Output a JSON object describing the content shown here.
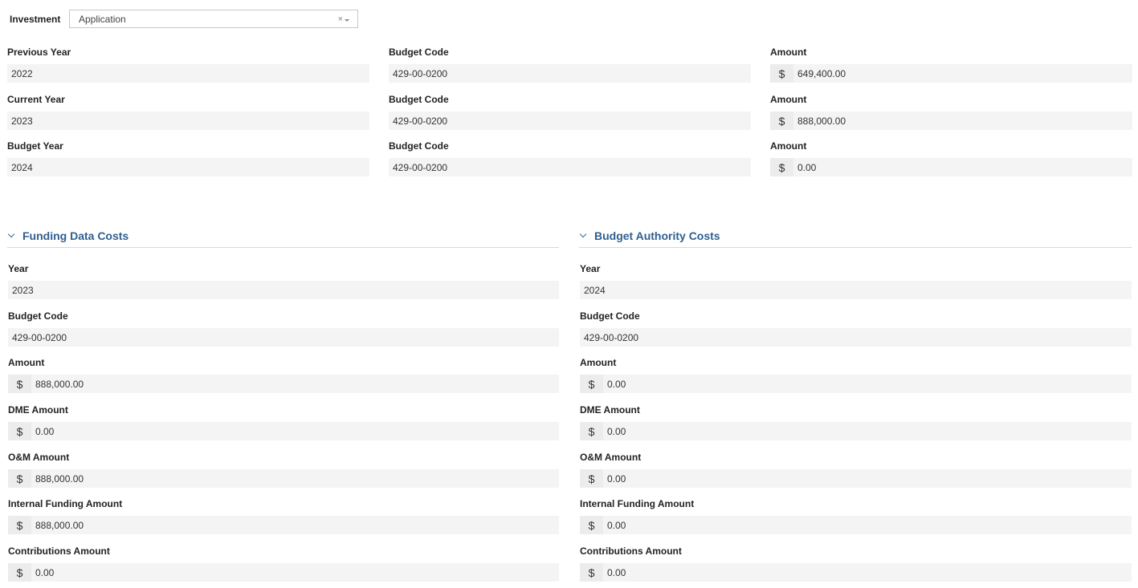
{
  "investment": {
    "label": "Investment",
    "value": "Application",
    "clear": "×"
  },
  "summary": [
    {
      "year_label": "Previous Year",
      "year": "2022",
      "code_label": "Budget Code",
      "code": "429-00-0200",
      "amount_label": "Amount",
      "amount": "649,400.00"
    },
    {
      "year_label": "Current Year",
      "year": "2023",
      "code_label": "Budget Code",
      "code": "429-00-0200",
      "amount_label": "Amount",
      "amount": "888,000.00"
    },
    {
      "year_label": "Budget Year",
      "year": "2024",
      "code_label": "Budget Code",
      "code": "429-00-0200",
      "amount_label": "Amount",
      "amount": "0.00"
    }
  ],
  "currency_symbol": "$",
  "funding": {
    "title": "Funding Data Costs",
    "year_label": "Year",
    "year": "2023",
    "code_label": "Budget Code",
    "code": "429-00-0200",
    "amount_label": "Amount",
    "amount": "888,000.00",
    "dme_label": "DME Amount",
    "dme": "0.00",
    "om_label": "O&M Amount",
    "om": "888,000.00",
    "internal_label": "Internal Funding Amount",
    "internal": "888,000.00",
    "contrib_label": "Contributions Amount",
    "contrib": "0.00"
  },
  "authority": {
    "title": "Budget Authority Costs",
    "year_label": "Year",
    "year": "2024",
    "code_label": "Budget Code",
    "code": "429-00-0200",
    "amount_label": "Amount",
    "amount": "0.00",
    "dme_label": "DME Amount",
    "dme": "0.00",
    "om_label": "O&M Amount",
    "om": "0.00",
    "internal_label": "Internal Funding Amount",
    "internal": "0.00",
    "contrib_label": "Contributions Amount",
    "contrib": "0.00"
  },
  "colors": {
    "accent": "#2f5f8f",
    "field_bg": "#f4f4f4"
  }
}
